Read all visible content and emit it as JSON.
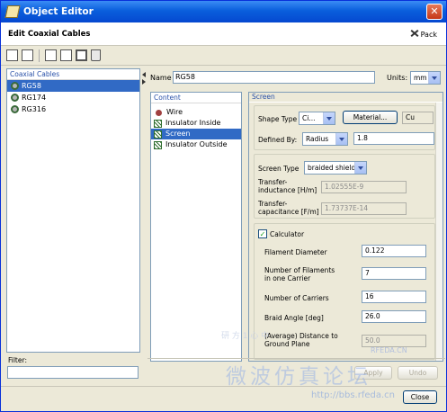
{
  "window": {
    "title": "Object Editor"
  },
  "header": {
    "title": "Edit Coaxial Cables",
    "pack_label": "Pack"
  },
  "toolbar": {
    "icons": [
      "new-icon",
      "copy-icon",
      "import-icon",
      "export-icon",
      "select-icon",
      "delete-icon"
    ]
  },
  "cables_panel": {
    "title": "Coaxial Cables",
    "items": [
      {
        "label": "RG58",
        "selected": true
      },
      {
        "label": "RG174",
        "selected": false
      },
      {
        "label": "RG316",
        "selected": false
      }
    ]
  },
  "filter": {
    "label": "Filter:",
    "value": ""
  },
  "name_row": {
    "label": "Name",
    "value": "RG58",
    "units_label": "Units:",
    "units_value": "mm"
  },
  "content_panel": {
    "title": "Content",
    "items": [
      {
        "label": "Wire",
        "icon": "wire-icon",
        "selected": false
      },
      {
        "label": "Insulator Inside",
        "icon": "insulator-icon",
        "selected": false
      },
      {
        "label": "Screen",
        "icon": "screen-icon",
        "selected": true
      },
      {
        "label": "Insulator Outside",
        "icon": "insulator-icon",
        "selected": false
      }
    ]
  },
  "screen_panel": {
    "title": "Screen",
    "shape_type_label": "Shape Type",
    "shape_type_value": "Ci...",
    "material_button": "Material...",
    "material_value": "Cu",
    "defined_by_label": "Defined By:",
    "defined_by_value": "Radius",
    "radius_value": "1.8",
    "screen_type_label": "Screen Type",
    "screen_type_value": "braided shield",
    "transfer_inductance_label_1": "Transfer-",
    "transfer_inductance_label_2": "inductance [H/m]",
    "transfer_inductance_value": "1.02555E-9",
    "transfer_capacitance_label_1": "Transfer-",
    "transfer_capacitance_label_2": "capacitance [F/m]",
    "transfer_capacitance_value": "1.73737E-14",
    "calculator_label": "Calculator",
    "calculator_checked": true,
    "filament_diameter_label": "Filament Diameter",
    "filament_diameter_value": "0.122",
    "filaments_label_1": "Number of Filaments",
    "filaments_label_2": "in one Carrier",
    "filaments_value": "7",
    "carriers_label": "Number of Carriers",
    "carriers_value": "16",
    "braid_angle_label": "Braid Angle [deg]",
    "braid_angle_value": "26.0",
    "distance_label_1": "(Average) Distance to",
    "distance_label_2": "Ground Plane",
    "distance_value": "50.0"
  },
  "bottom_buttons": {
    "apply": "Apply",
    "undo": "Undo",
    "close": "Close"
  },
  "watermark": {
    "text": "微波仿真论坛",
    "url": "http://bbs.rfeda.cn",
    "brand": "RFEDA.CN",
    "small": "研 方 1 心 中"
  },
  "colors": {
    "title_bar": "#0a5fdc",
    "selection": "#316ac5",
    "panel_title": "#2850a8"
  }
}
